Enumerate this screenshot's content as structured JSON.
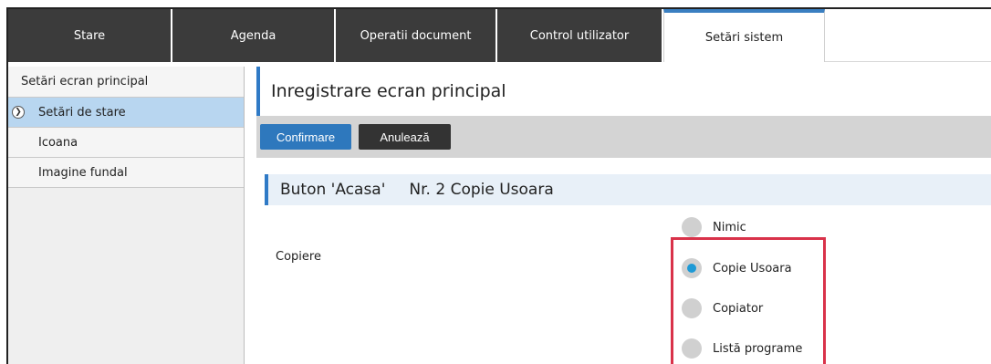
{
  "tabs": [
    {
      "label": "Stare",
      "active": false
    },
    {
      "label": "Agenda",
      "active": false
    },
    {
      "label": "Operatii document",
      "active": false
    },
    {
      "label": "Control utilizator",
      "active": false
    },
    {
      "label": "Setări sistem",
      "active": true
    }
  ],
  "sidebar": {
    "header": "Setări ecran principal",
    "items": [
      {
        "label": "Setări de stare",
        "active": true
      },
      {
        "label": "Icoana",
        "active": false
      },
      {
        "label": "Imagine fundal",
        "active": false
      }
    ]
  },
  "main": {
    "title": "Inregistrare ecran principal",
    "toolbar": {
      "confirm_label": "Confirmare",
      "cancel_label": "Anulează"
    },
    "section": {
      "label": "Buton 'Acasa'",
      "value": "Nr. 2 Copie Usoara"
    },
    "field_label": "Copiere",
    "options": [
      {
        "label": "Nimic",
        "checked": false
      },
      {
        "label": "Copie Usoara",
        "checked": true
      },
      {
        "label": "Copiator",
        "checked": false
      },
      {
        "label": "Listă programe",
        "checked": false
      }
    ]
  },
  "colors": {
    "accent": "#2f7ac6",
    "highlight": "#d9324a",
    "radio_selected": "#1e9ad6"
  }
}
